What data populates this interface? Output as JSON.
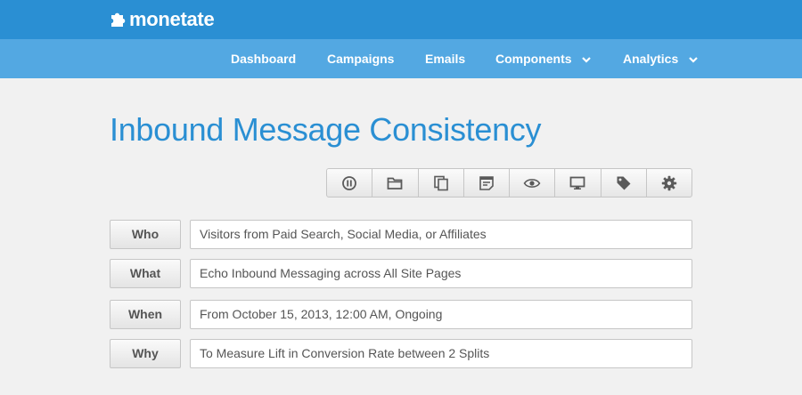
{
  "brand": {
    "name": "monetate",
    "color": "#2a8fd3"
  },
  "nav": {
    "items": [
      {
        "label": "Dashboard",
        "dropdown": false
      },
      {
        "label": "Campaigns",
        "dropdown": false
      },
      {
        "label": "Emails",
        "dropdown": false
      },
      {
        "label": "Components",
        "dropdown": true
      },
      {
        "label": "Analytics",
        "dropdown": true
      }
    ]
  },
  "page": {
    "title": "Inbound Message Consistency"
  },
  "toolbar": {
    "icons": [
      "pause-icon",
      "folder-icon",
      "copy-icon",
      "notes-icon",
      "preview-eye-icon",
      "monitor-icon",
      "tag-icon",
      "gear-icon"
    ]
  },
  "rows": [
    {
      "label": "Who",
      "value": "Visitors from Paid Search, Social Media, or Affiliates"
    },
    {
      "label": "What",
      "value": "Echo Inbound Messaging across All Site Pages"
    },
    {
      "label": "When",
      "value": "From October 15, 2013, 12:00 AM, Ongoing"
    },
    {
      "label": "Why",
      "value": "To Measure Lift in Conversion Rate between 2 Splits"
    }
  ],
  "colors": {
    "topbar": "#2a8fd3",
    "navbar": "#53a8e2",
    "background": "#f1f1f1",
    "icon": "#5a5a5a"
  }
}
